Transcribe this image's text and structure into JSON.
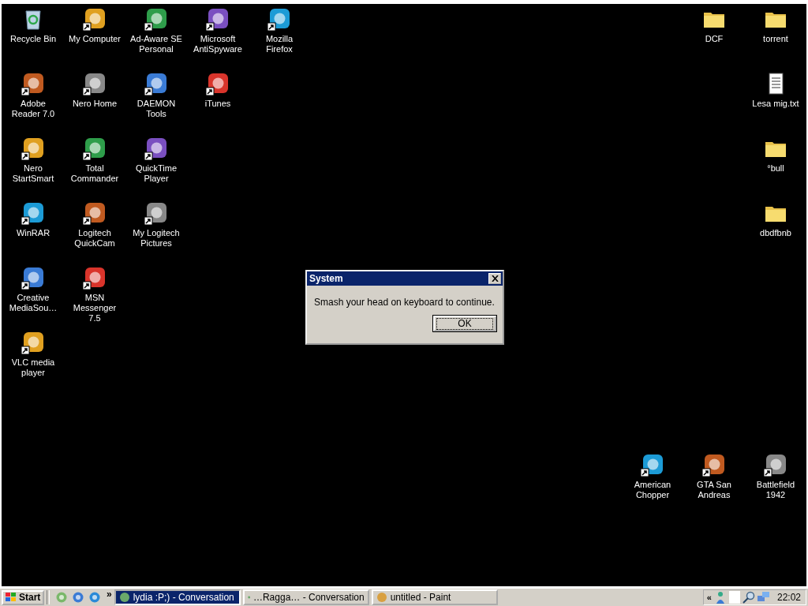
{
  "desktop": {
    "left_rows": [
      [
        {
          "label": "Recycle Bin",
          "kind": "bin",
          "shortcut": false
        },
        {
          "label": "My Computer",
          "kind": "app",
          "shortcut": true
        },
        {
          "label": "Ad-Aware SE Personal",
          "kind": "app",
          "shortcut": true
        },
        {
          "label": "Microsoft AntiSpyware",
          "kind": "app",
          "shortcut": true
        },
        {
          "label": "Mozilla Firefox",
          "kind": "app",
          "shortcut": true
        }
      ],
      [
        {
          "label": "Adobe Reader 7.0",
          "kind": "app",
          "shortcut": true
        },
        {
          "label": "Nero Home",
          "kind": "app",
          "shortcut": true
        },
        {
          "label": "DAEMON Tools",
          "kind": "app",
          "shortcut": true
        },
        {
          "label": "iTunes",
          "kind": "app",
          "shortcut": true
        }
      ],
      [
        {
          "label": "Nero StartSmart",
          "kind": "app",
          "shortcut": true
        },
        {
          "label": "Total Commander",
          "kind": "app",
          "shortcut": true
        },
        {
          "label": "QuickTime Player",
          "kind": "app",
          "shortcut": true
        }
      ],
      [
        {
          "label": "WinRAR",
          "kind": "app",
          "shortcut": true
        },
        {
          "label": "Logitech QuickCam",
          "kind": "app",
          "shortcut": true
        },
        {
          "label": "My Logitech Pictures",
          "kind": "app",
          "shortcut": true
        }
      ],
      [
        {
          "label": "Creative MediaSou…",
          "kind": "app",
          "shortcut": true
        },
        {
          "label": "MSN Messenger 7.5",
          "kind": "app",
          "shortcut": true
        }
      ],
      [
        {
          "label": "VLC media player",
          "kind": "app",
          "shortcut": true
        }
      ]
    ],
    "right_rows": [
      [
        {
          "label": "DCF",
          "kind": "folder",
          "shortcut": false
        },
        {
          "label": "torrent",
          "kind": "folder",
          "shortcut": false
        }
      ],
      [
        {
          "label": "Lesa mig.txt",
          "kind": "document",
          "shortcut": false
        }
      ],
      [
        {
          "label": "°bull",
          "kind": "folder",
          "shortcut": false
        }
      ],
      [
        {
          "label": "dbdfbnb",
          "kind": "folder",
          "shortcut": false
        }
      ]
    ],
    "bottom_right_rows": [
      [
        {
          "label": "American Chopper",
          "kind": "app",
          "shortcut": true
        },
        {
          "label": "GTA San Andreas",
          "kind": "app",
          "shortcut": true
        },
        {
          "label": "Battlefield 1942",
          "kind": "app",
          "shortcut": true
        }
      ]
    ]
  },
  "dialog": {
    "title": "System",
    "message": "Smash your head on keyboard to continue.",
    "buttons": [
      {
        "label": "OK",
        "focused": true
      }
    ]
  },
  "taskbar": {
    "start": "Start",
    "more": "»",
    "tasks": [
      {
        "label": "lydia :P;) - Conversation",
        "selected": true
      },
      {
        "label": "…Ragga… - Conversation",
        "selected": false
      },
      {
        "label": "untitled - Paint",
        "selected": false
      }
    ],
    "tray": {
      "more": "«",
      "clock": "22:02"
    }
  }
}
